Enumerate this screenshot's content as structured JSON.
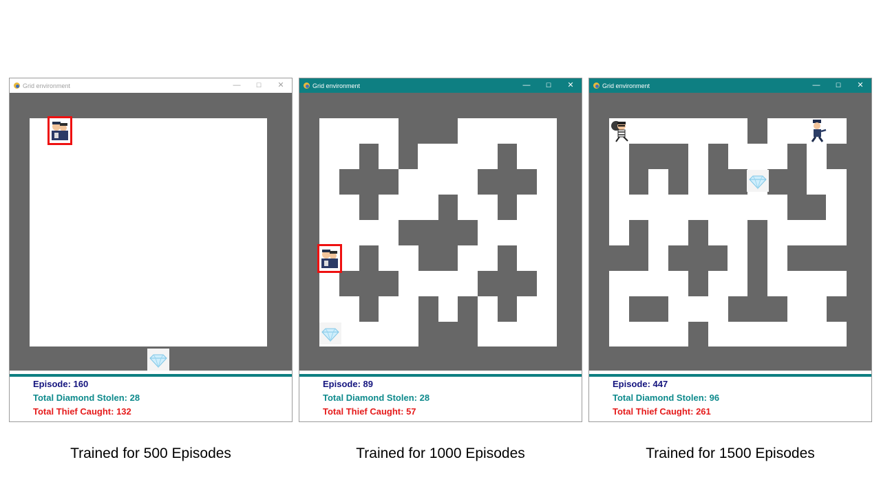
{
  "colors": {
    "accent": "#0e7f82",
    "wall": "#676767",
    "episode": "#14147e",
    "diamonds": "#0e8a8c",
    "caught": "#e51b1b"
  },
  "panels": [
    {
      "window_title": "Grid environment",
      "controls": {
        "minimize": "—",
        "maximize": "☐",
        "close": "✕"
      },
      "episode": "Episode: 160",
      "diamonds": "Total Diamond Stolen: 28",
      "caught": "Total Thief Caught: 132",
      "caption": "Trained for 500 Episodes",
      "sprites": [
        "thief-caught-icon",
        "diamond-icon"
      ]
    },
    {
      "window_title": "Grid environment",
      "controls": {
        "minimize": "—",
        "maximize": "☐",
        "close": "✕"
      },
      "episode": "Episode: 89",
      "diamonds": "Total Diamond Stolen: 28",
      "caught": "Total Thief Caught: 57",
      "caption": "Trained for 1000 Episodes",
      "sprites": [
        "thief-caught-icon",
        "diamond-icon"
      ]
    },
    {
      "window_title": "Grid environment",
      "controls": {
        "minimize": "—",
        "maximize": "☐",
        "close": "✕"
      },
      "episode": "Episode: 447",
      "diamonds": "Total Diamond Stolen: 96",
      "caught": "Total Thief Caught: 261",
      "caption": "Trained for 1500 Episodes",
      "sprites": [
        "thief-icon",
        "police-icon",
        "diamond-icon"
      ]
    }
  ]
}
